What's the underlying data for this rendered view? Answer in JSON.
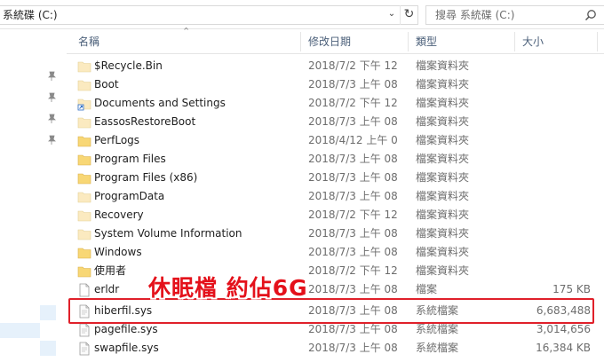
{
  "address": {
    "path": "系統碟 (C:)",
    "dropdown_icon": "chevron-down-icon",
    "refresh_icon": "refresh-icon"
  },
  "search": {
    "placeholder": "搜尋 系統碟 (C:)",
    "icon": "search-icon"
  },
  "columns": {
    "name": "名稱",
    "date": "修改日期",
    "type": "類型",
    "size": "大小"
  },
  "files": [
    {
      "name": "$Recycle.Bin",
      "date": "2018/7/2 下午 12",
      "type": "檔案資料夾",
      "size": "",
      "icon": "folder-pale-icon"
    },
    {
      "name": "Boot",
      "date": "2018/7/3 上午 08",
      "type": "檔案資料夾",
      "size": "",
      "icon": "folder-pale-icon"
    },
    {
      "name": "Documents and Settings",
      "date": "2018/7/2 下午 12",
      "type": "檔案資料夾",
      "size": "",
      "icon": "folder-shortcut-icon"
    },
    {
      "name": "EassosRestoreBoot",
      "date": "2018/7/3 上午 08",
      "type": "檔案資料夾",
      "size": "",
      "icon": "folder-pale-icon"
    },
    {
      "name": "PerfLogs",
      "date": "2018/4/12 上午 0",
      "type": "檔案資料夾",
      "size": "",
      "icon": "folder-icon"
    },
    {
      "name": "Program Files",
      "date": "2018/7/3 上午 08",
      "type": "檔案資料夾",
      "size": "",
      "icon": "folder-icon"
    },
    {
      "name": "Program Files (x86)",
      "date": "2018/7/3 上午 08",
      "type": "檔案資料夾",
      "size": "",
      "icon": "folder-icon"
    },
    {
      "name": "ProgramData",
      "date": "2018/7/3 上午 08",
      "type": "檔案資料夾",
      "size": "",
      "icon": "folder-pale-icon"
    },
    {
      "name": "Recovery",
      "date": "2018/7/2 下午 12",
      "type": "檔案資料夾",
      "size": "",
      "icon": "folder-pale-icon"
    },
    {
      "name": "System Volume Information",
      "date": "2018/7/3 上午 08",
      "type": "檔案資料夾",
      "size": "",
      "icon": "folder-pale-icon"
    },
    {
      "name": "Windows",
      "date": "2018/7/3 上午 08",
      "type": "檔案資料夾",
      "size": "",
      "icon": "folder-icon"
    },
    {
      "name": "使用者",
      "date": "2018/7/2 下午 12",
      "type": "檔案資料夾",
      "size": "",
      "icon": "folder-icon"
    },
    {
      "name": "erldr",
      "date": "2018/7/3 上午 08",
      "type": "檔案",
      "size": "175 KB",
      "icon": "file-icon"
    },
    {
      "name": "hiberfil.sys",
      "date": "2018/7/3 上午 08",
      "type": "系統檔案",
      "size": "6,683,488",
      "icon": "system-file-icon"
    },
    {
      "name": "pagefile.sys",
      "date": "2018/7/3 上午 08",
      "type": "系統檔案",
      "size": "3,014,656",
      "icon": "system-file-icon"
    },
    {
      "name": "swapfile.sys",
      "date": "2018/7/3 上午 08",
      "type": "系統檔案",
      "size": "16,384 KB",
      "icon": "system-file-icon"
    }
  ],
  "annotation": {
    "text": "休眠檔  約佔6G"
  },
  "colors": {
    "annotation": "#e4111b",
    "folder": "#f8d775",
    "folder_pale": "#fbeac0",
    "header_text": "#4c607a"
  }
}
